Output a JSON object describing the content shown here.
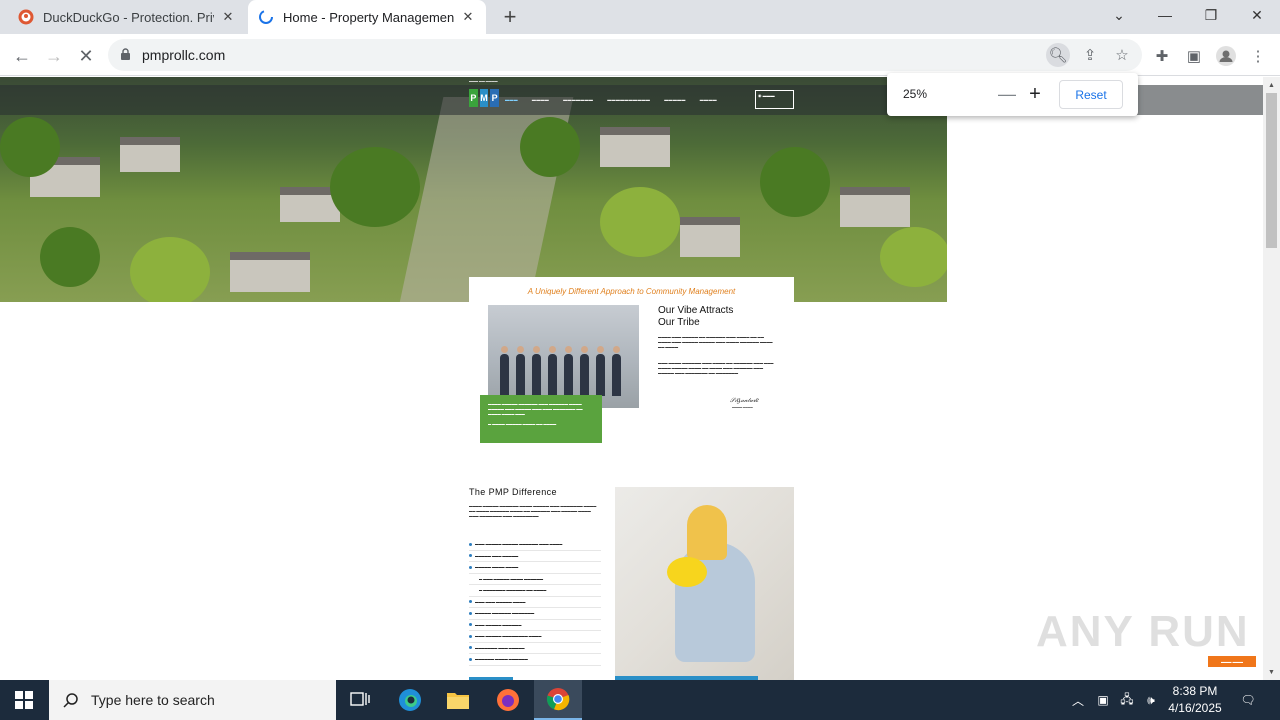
{
  "browser": {
    "tabs": [
      {
        "title": "DuckDuckGo - Protection. Privac",
        "icon": "duckduckgo-icon"
      },
      {
        "title": "Home - Property Management P",
        "icon": "loading-icon"
      }
    ],
    "url": "pmprollc.com",
    "zoom_popup": {
      "percent": "25%",
      "reset_label": "Reset"
    }
  },
  "site": {
    "logo_letters": [
      "P",
      "M",
      "P"
    ],
    "logo_colors": [
      "#3aa43c",
      "#2a8fc7",
      "#2a6db4"
    ],
    "card_heading": "A Uniquely Different Approach to Community Management",
    "vibe_title_line1": "Our Vibe Attracts",
    "vibe_title_line2": "Our Tribe",
    "pmp_title": "The PMP Difference",
    "accent_color": "#e0801e",
    "green_color": "#5aa33e",
    "blue_color": "#2a8fc7"
  },
  "watermark": "ANY RUN",
  "taskbar": {
    "search_placeholder": "Type here to search",
    "time": "8:38 PM",
    "date": "4/16/2025"
  }
}
